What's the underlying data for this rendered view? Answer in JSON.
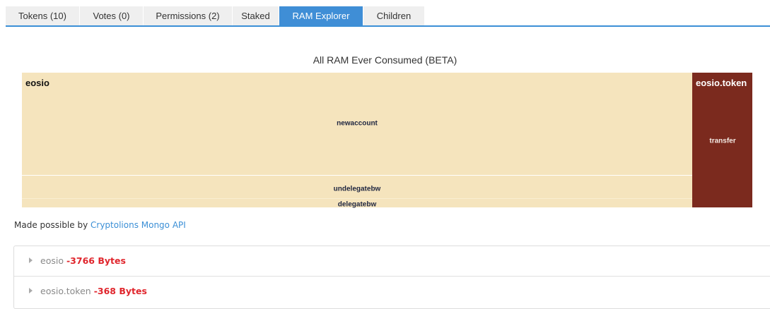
{
  "tabs": [
    {
      "label": "Tokens (10)",
      "active": false
    },
    {
      "label": "Votes (0)",
      "active": false
    },
    {
      "label": "Permissions (2)",
      "active": false
    },
    {
      "label": "Staked",
      "active": false
    },
    {
      "label": "RAM Explorer",
      "active": true
    },
    {
      "label": "Children",
      "active": false
    }
  ],
  "chart_data": {
    "type": "treemap",
    "title": "All RAM Ever Consumed (BETA)",
    "groups": [
      {
        "name": "eosio",
        "color": "#f5e4bd",
        "children": [
          {
            "name": "newaccount"
          },
          {
            "name": "undelegatebw"
          },
          {
            "name": "delegatebw"
          }
        ]
      },
      {
        "name": "eosio.token",
        "color": "#7b2a1e",
        "children": [
          {
            "name": "transfer"
          }
        ]
      }
    ]
  },
  "credit": {
    "prefix": "Made possible by ",
    "link_text": "Cryptolions Mongo API"
  },
  "ram_list": [
    {
      "name": "eosio",
      "bytes": "-3766 Bytes"
    },
    {
      "name": "eosio.token",
      "bytes": "-368 Bytes"
    }
  ],
  "colors": {
    "accent": "#3b8fd6",
    "negative": "#e0262d"
  }
}
